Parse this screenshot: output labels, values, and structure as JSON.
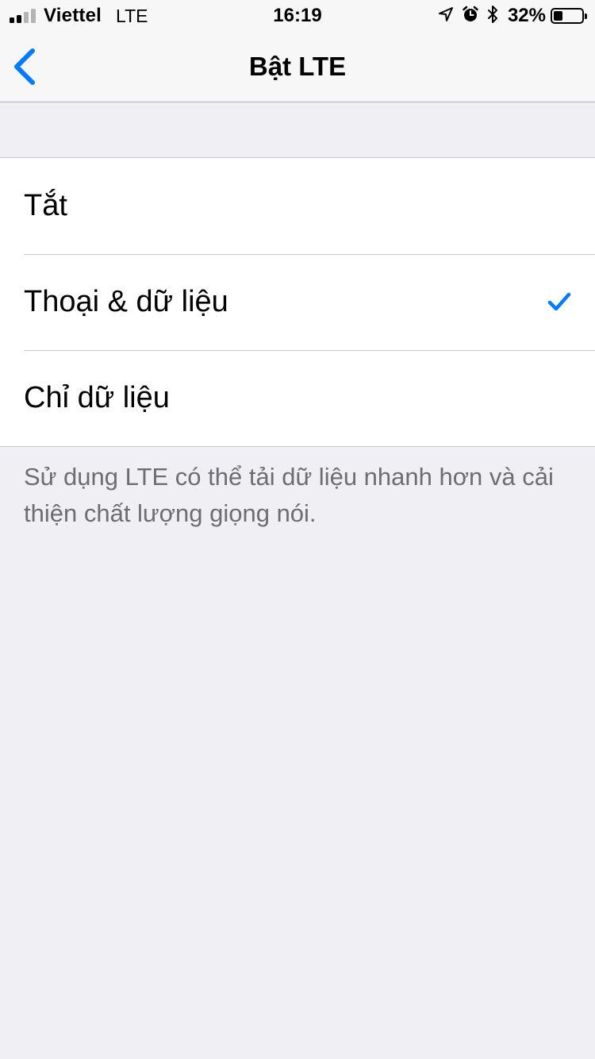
{
  "status_bar": {
    "carrier": "Viettel",
    "network": "LTE",
    "time": "16:19",
    "battery_percent": "32%",
    "battery_level": 0.32,
    "signal_bars_filled": 2,
    "icons": [
      "location-arrow-icon",
      "alarm-clock-icon",
      "bluetooth-icon"
    ]
  },
  "nav": {
    "title": "Bật LTE",
    "back_icon": "chevron-left-icon"
  },
  "options": [
    {
      "label": "Tắt",
      "selected": false
    },
    {
      "label": "Thoại & dữ liệu",
      "selected": true
    },
    {
      "label": "Chỉ dữ liệu",
      "selected": false
    }
  ],
  "footer": {
    "text": "Sử dụng LTE có thể tải dữ liệu nhanh hơn và cải thiện chất lượng giọng nói."
  },
  "colors": {
    "accent": "#007aff",
    "background": "#efeff4",
    "footer_text": "#6d6d72"
  }
}
